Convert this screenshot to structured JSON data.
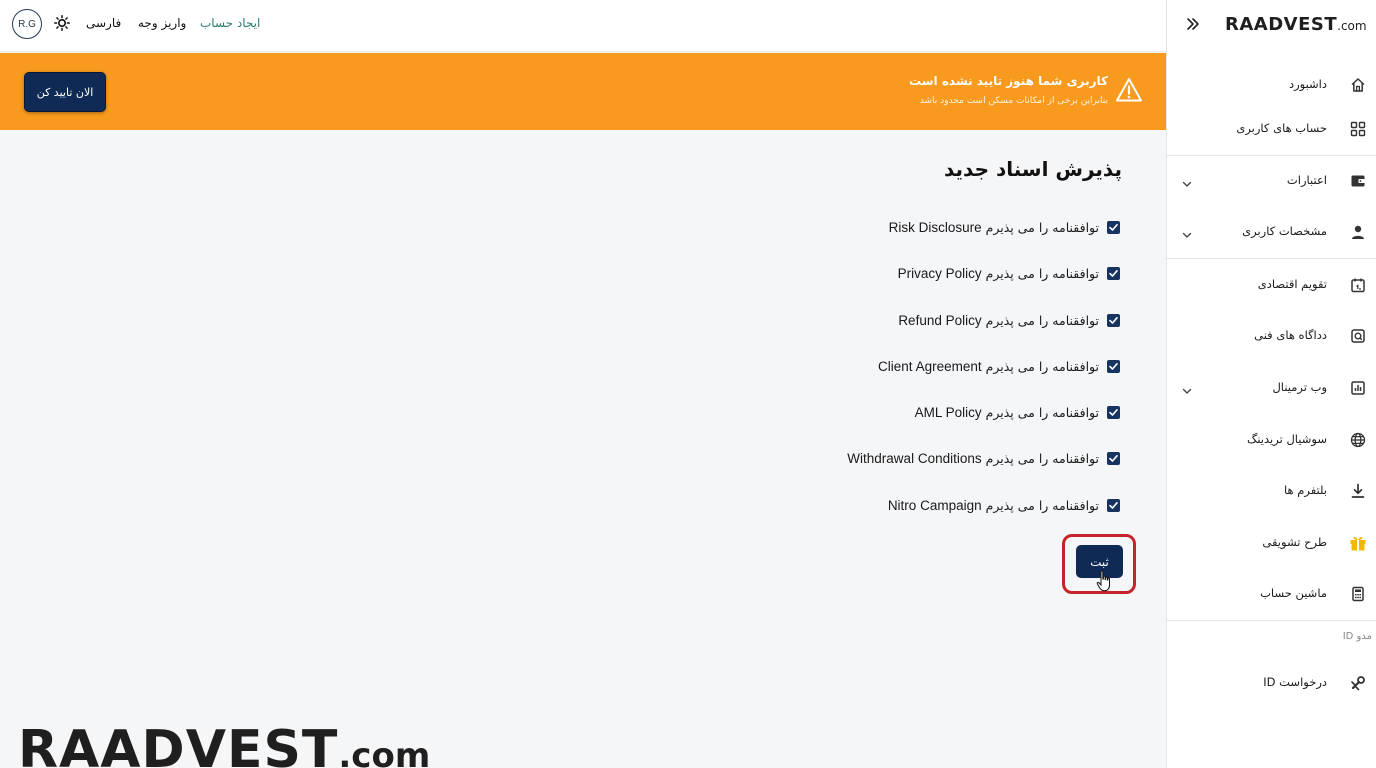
{
  "topbar": {
    "avatar_initials": "R.G",
    "language": "فارسی",
    "deposit": "واریز وجه",
    "create_account": "ایجاد حساب"
  },
  "banner": {
    "title": "کاربری شما هنوز تایید نشده است",
    "subtitle": "بنابراین برخی از امکانات مسکن است محدود باشد",
    "button_label": "الان تایید کن",
    "color": "#f79a1d"
  },
  "main": {
    "title": "پذیرش اسناد جدید",
    "agree_prefix": "توافقنامه را می پذیرم",
    "agreements": [
      {
        "name": "Risk Disclosure",
        "checked": true
      },
      {
        "name": "Privacy Policy",
        "checked": true
      },
      {
        "name": "Refund Policy",
        "checked": true
      },
      {
        "name": "Client Agreement",
        "checked": true
      },
      {
        "name": "AML Policy",
        "checked": true
      },
      {
        "name": "Withdrawal Conditions",
        "checked": true
      },
      {
        "name": "Nitro Campaign",
        "checked": true
      }
    ],
    "submit_label": "ثبت",
    "watermark_main": "RAADVEST",
    "watermark_suffix": ".com"
  },
  "sidebar": {
    "logo_main": "RAADVEST",
    "logo_suffix": ".com",
    "items": [
      {
        "label": "داشبورد",
        "icon": "home-icon"
      },
      {
        "label": "حساب های کاربری",
        "icon": "grid-icon"
      },
      {
        "label": "اعتبارات",
        "icon": "wallet-icon",
        "expandable": true
      },
      {
        "label": "مشخصات کاربری",
        "icon": "user-icon",
        "expandable": true
      },
      {
        "label": "تقویم اقتصادی",
        "icon": "calendar-icon"
      },
      {
        "label": "دداگاه های فنی",
        "icon": "technical-icon"
      },
      {
        "label": "وب ترمینال",
        "icon": "chart-icon",
        "expandable": true
      },
      {
        "label": "سوشیال تریدینگ",
        "icon": "globe-icon"
      },
      {
        "label": "بلتفرم ها",
        "icon": "download-icon"
      },
      {
        "label": "طرح تشویقی",
        "icon": "gift-icon"
      },
      {
        "label": "ماشین حساب",
        "icon": "calculator-icon"
      }
    ],
    "section_label": "مدو ID",
    "id_request": "درخواست ID"
  },
  "colors": {
    "navy": "#0f2a55",
    "accent_orange": "#f79a1d",
    "gift_yellow": "#f5b800",
    "highlight_red": "#c6242b",
    "link_teal": "#2b7a6f"
  }
}
